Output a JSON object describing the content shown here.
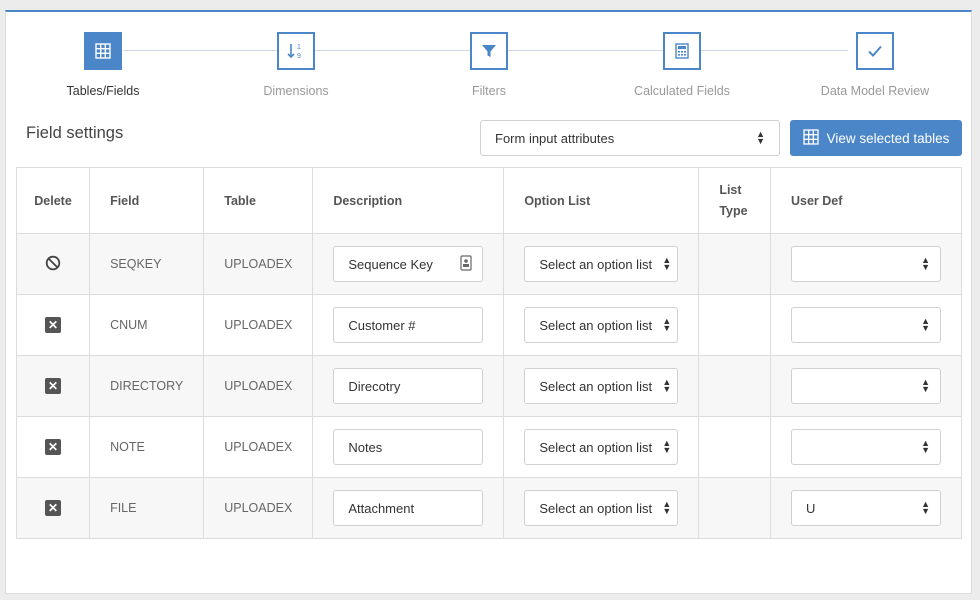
{
  "wizard": {
    "steps": [
      {
        "label": "Tables/Fields",
        "icon": "grid-icon",
        "active": true
      },
      {
        "label": "Dimensions",
        "icon": "sort-numeric-icon",
        "active": false
      },
      {
        "label": "Filters",
        "icon": "filter-icon",
        "active": false
      },
      {
        "label": "Calculated Fields",
        "icon": "calculator-icon",
        "active": false
      },
      {
        "label": "Data Model Review",
        "icon": "check-icon",
        "active": false
      }
    ]
  },
  "header": {
    "title": "Field settings",
    "attr_select": "Form input attributes",
    "view_button": "View selected tables"
  },
  "table": {
    "columns": {
      "delete": "Delete",
      "field": "Field",
      "table": "Table",
      "description": "Description",
      "option_list": "Option List",
      "list_type_1": "List",
      "list_type_2": "Type",
      "user_def": "User Def"
    },
    "rows": [
      {
        "delete_icon": "ban-icon",
        "field": "SEQKEY",
        "table": "UPLOADEX",
        "description": "Sequence Key",
        "option_list": "Select an option list",
        "list_type": "",
        "user_def": ""
      },
      {
        "delete_icon": "delete-x-icon",
        "field": "CNUM",
        "table": "UPLOADEX",
        "description": "Customer #",
        "option_list": "Select an option list",
        "list_type": "",
        "user_def": ""
      },
      {
        "delete_icon": "delete-x-icon",
        "field": "DIRECTORY",
        "table": "UPLOADEX",
        "description": "Direcotry",
        "option_list": "Select an option list",
        "list_type": "",
        "user_def": ""
      },
      {
        "delete_icon": "delete-x-icon",
        "field": "NOTE",
        "table": "UPLOADEX",
        "description": "Notes",
        "option_list": "Select an option list",
        "list_type": "",
        "user_def": ""
      },
      {
        "delete_icon": "delete-x-icon",
        "field": "FILE",
        "table": "UPLOADEX",
        "description": "Attachment",
        "option_list": "Select an option list",
        "list_type": "",
        "user_def": "U"
      }
    ]
  },
  "colors": {
    "accent": "#4a86c8",
    "border": "#dcdcdc"
  }
}
